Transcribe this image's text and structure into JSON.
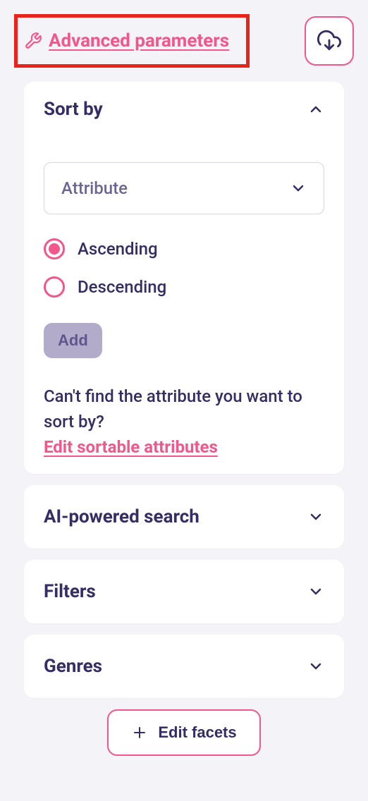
{
  "header": {
    "advanced_link": "Advanced parameters"
  },
  "sort": {
    "title": "Sort by",
    "attribute_placeholder": "Attribute",
    "ascending": "Ascending",
    "descending": "Descending",
    "add_button": "Add",
    "help_text": "Can't find the attribute you want to sort by?",
    "edit_link": "Edit sortable attributes"
  },
  "sections": {
    "ai_search": "AI-powered search",
    "filters": "Filters",
    "genres": "Genres"
  },
  "footer": {
    "edit_facets": "Edit facets"
  }
}
